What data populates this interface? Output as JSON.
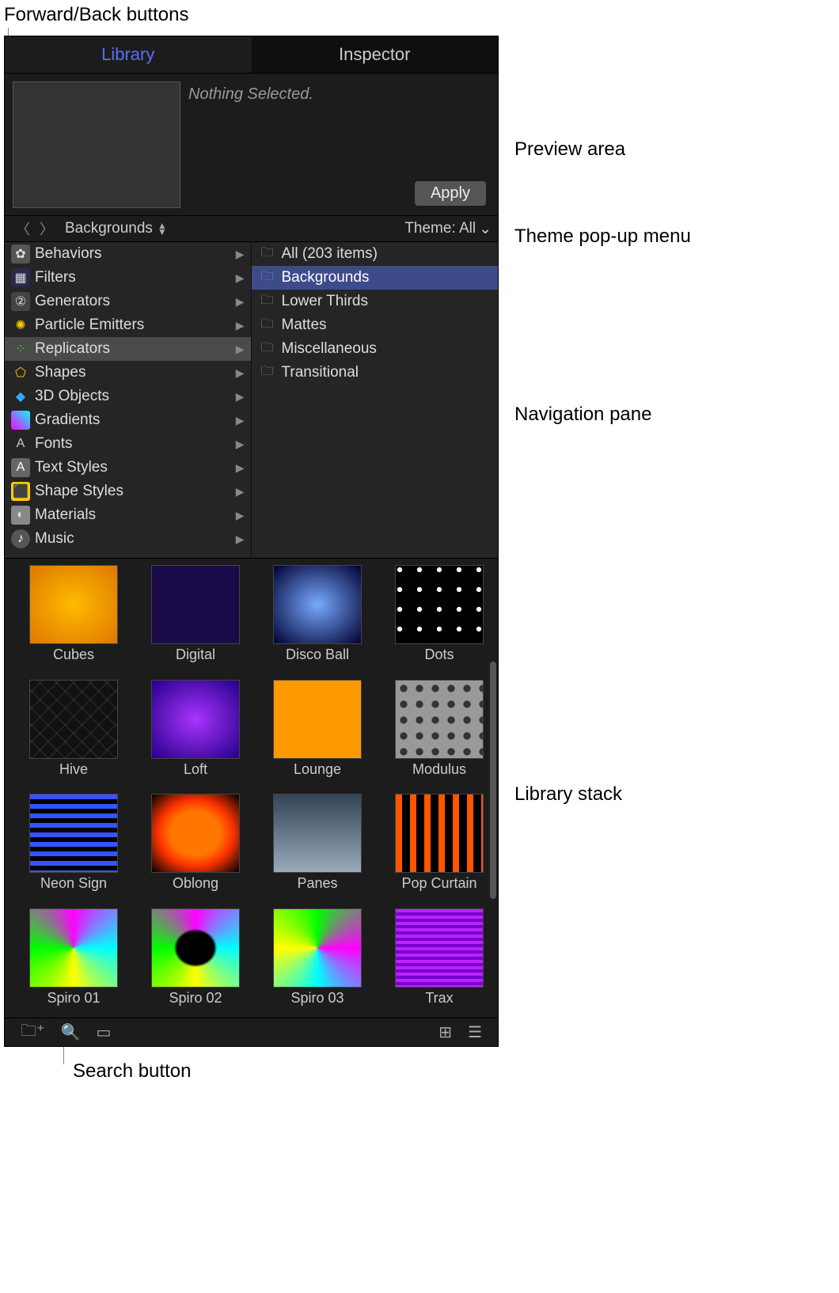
{
  "annotations": {
    "forward_back": "Forward/Back buttons",
    "preview_area": "Preview area",
    "theme_popup": "Theme pop-up menu",
    "navigation_pane": "Navigation pane",
    "library_stack": "Library stack",
    "search_button": "Search button"
  },
  "tabs": {
    "library": "Library",
    "inspector": "Inspector"
  },
  "preview": {
    "status": "Nothing Selected.",
    "apply": "Apply"
  },
  "navbar": {
    "breadcrumb": "Backgrounds",
    "theme": "Theme: All"
  },
  "categories": [
    {
      "label": "Behaviors"
    },
    {
      "label": "Filters"
    },
    {
      "label": "Generators"
    },
    {
      "label": "Particle Emitters"
    },
    {
      "label": "Replicators"
    },
    {
      "label": "Shapes"
    },
    {
      "label": "3D Objects"
    },
    {
      "label": "Gradients"
    },
    {
      "label": "Fonts"
    },
    {
      "label": "Text Styles"
    },
    {
      "label": "Shape Styles"
    },
    {
      "label": "Materials"
    },
    {
      "label": "Music"
    }
  ],
  "subcategories": [
    {
      "label": "All (203 items)"
    },
    {
      "label": "Backgrounds"
    },
    {
      "label": "Lower Thirds"
    },
    {
      "label": "Mattes"
    },
    {
      "label": "Miscellaneous"
    },
    {
      "label": "Transitional"
    }
  ],
  "stack_items": [
    "Cubes",
    "Digital",
    "Disco Ball",
    "Dots",
    "Hive",
    "Loft",
    "Lounge",
    "Modulus",
    "Neon Sign",
    "Oblong",
    "Panes",
    "Pop Curtain",
    "Spiro 01",
    "Spiro 02",
    "Spiro 03",
    "Trax"
  ]
}
